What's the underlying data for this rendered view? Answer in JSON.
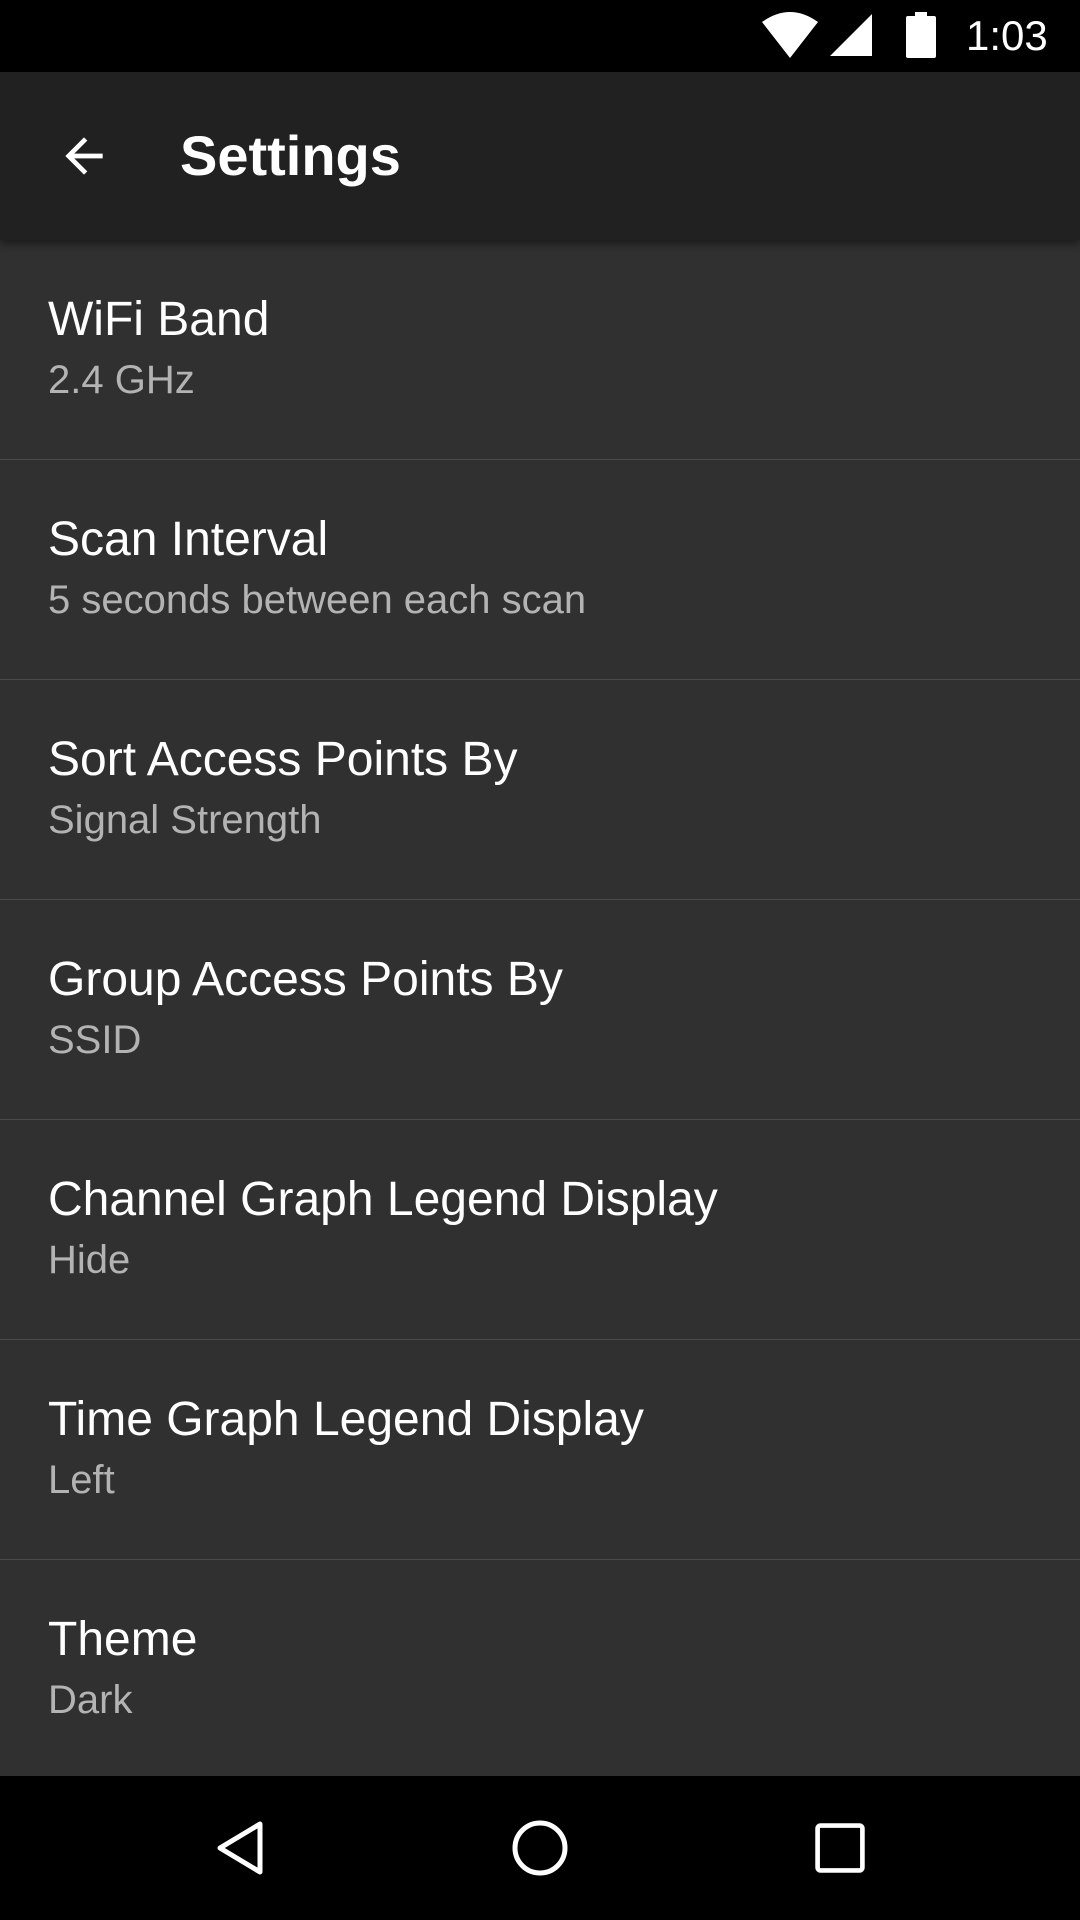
{
  "status_bar": {
    "time": "1:03",
    "icons": [
      "wifi-icon",
      "cell-signal-icon",
      "battery-icon"
    ]
  },
  "app_bar": {
    "title": "Settings",
    "back_icon": "arrow-back-icon"
  },
  "settings": [
    {
      "title": "WiFi Band",
      "summary": "2.4 GHz"
    },
    {
      "title": "Scan Interval",
      "summary": "5 seconds between each scan"
    },
    {
      "title": "Sort Access Points By",
      "summary": "Signal Strength"
    },
    {
      "title": "Group Access Points By",
      "summary": "SSID"
    },
    {
      "title": "Channel Graph Legend Display",
      "summary": "Hide"
    },
    {
      "title": "Time Graph Legend Display",
      "summary": "Left"
    },
    {
      "title": "Theme",
      "summary": "Dark"
    }
  ],
  "nav_bar": {
    "buttons": [
      "nav-back-icon",
      "nav-home-icon",
      "nav-recents-icon"
    ]
  },
  "colors": {
    "background": "#303030",
    "app_bar": "#212121",
    "system_bars": "#000000",
    "primary_text": "#ffffff",
    "secondary_text": "#b3b3b3",
    "divider": "#4a4a4a"
  }
}
